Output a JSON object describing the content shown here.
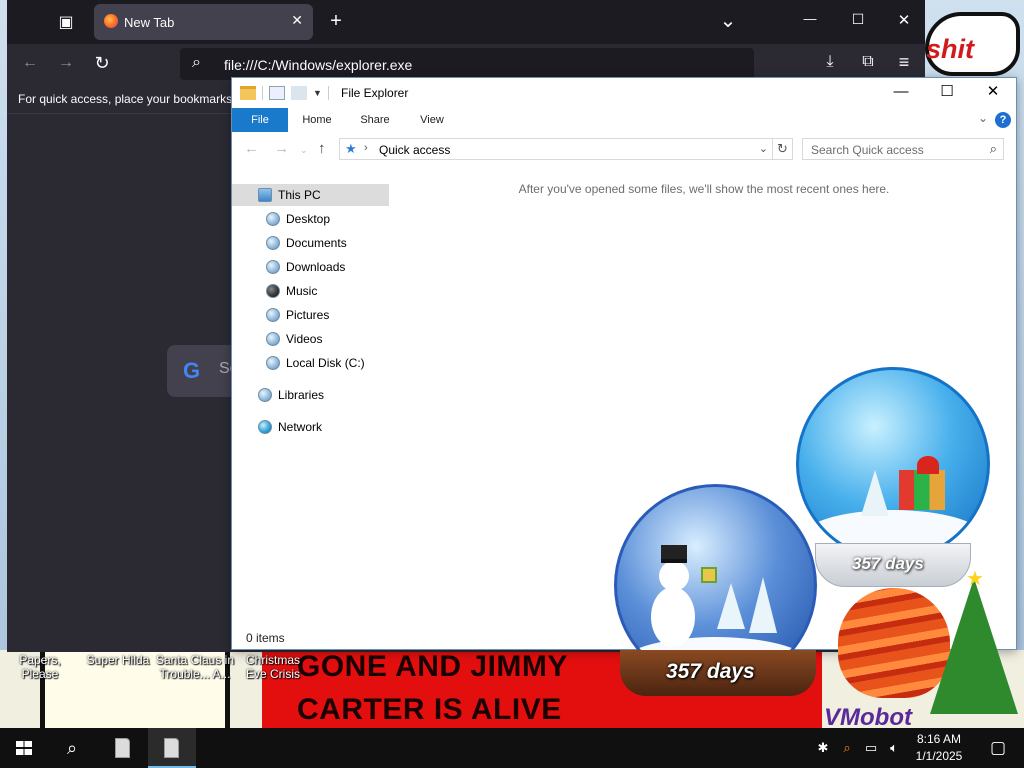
{
  "desktop": {
    "wallpaper_word": "shit",
    "banner": {
      "line1": "GONE AND JIMMY",
      "line2": "CARTER IS ALIVE"
    },
    "icons": [
      {
        "label": "Papers, Please"
      },
      {
        "label": "Super Hilda"
      },
      {
        "label": "Santa Claus in Trouble... A..."
      },
      {
        "label": "Christmas Eve Crisis"
      }
    ],
    "globe_left_label": "357 days",
    "globe_right_label": "357 days",
    "watermark": "VMobot"
  },
  "browser": {
    "tab": {
      "title": "New Tab",
      "close_glyph": "✕"
    },
    "new_tab_glyph": "+",
    "tab_list_glyph": "⌄",
    "window_controls": {
      "minimize": "—",
      "maximize": "☐",
      "close": "✕"
    },
    "url": "file:///C:/Windows/explorer.exe",
    "bookmarks_hint": "For quick access, place your bookmarks",
    "google_letter": "G",
    "search_placeholder_fragment": "Se"
  },
  "explorer": {
    "title": "File Explorer",
    "ribbon_tabs": [
      "File",
      "Home",
      "Share",
      "View"
    ],
    "help_glyph": "?",
    "address": "Quick access",
    "search_placeholder": "Search Quick access",
    "nav": [
      {
        "label": "This PC",
        "selected": true
      },
      {
        "label": "Desktop"
      },
      {
        "label": "Documents"
      },
      {
        "label": "Downloads"
      },
      {
        "label": "Music"
      },
      {
        "label": "Pictures"
      },
      {
        "label": "Videos"
      },
      {
        "label": "Local Disk (C:)"
      },
      {
        "label": "Libraries"
      },
      {
        "label": "Network"
      }
    ],
    "empty_message": "After you've opened some files, we'll show the most recent ones here.",
    "status": "0 items"
  },
  "taskbar": {
    "clock_time": "8:16 AM",
    "clock_date": "1/1/2025"
  },
  "colors": {
    "explorer_accent": "#1979ca",
    "browser_dark": "#2b2a33",
    "taskbar": "#101010",
    "banner_red": "#e30f0f"
  }
}
